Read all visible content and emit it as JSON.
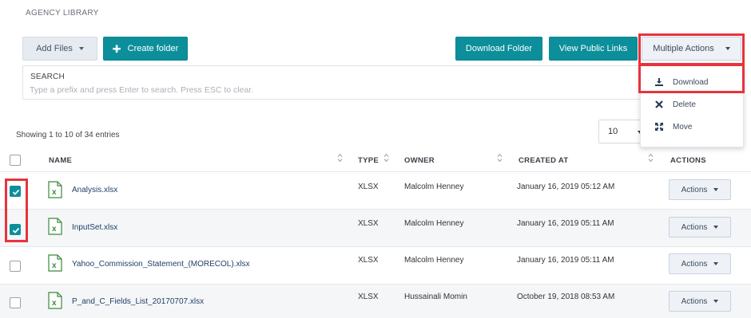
{
  "section_title": "AGENCY LIBRARY",
  "toolbar": {
    "add_files": "Add Files",
    "create_folder": "Create folder",
    "download_folder": "Download Folder",
    "view_public_links": "View Public Links",
    "multiple_actions": "Multiple Actions"
  },
  "multiple_actions_menu": {
    "items": [
      {
        "label": "Download",
        "icon": "download-icon"
      },
      {
        "label": "Delete",
        "icon": "close-icon"
      },
      {
        "label": "Move",
        "icon": "move-arrows-icon"
      }
    ]
  },
  "search": {
    "label": "SEARCH",
    "placeholder": "Type a prefix and press Enter to search. Press ESC to clear."
  },
  "entries_info": "Showing 1 to 10 of 34 entries",
  "per_page": "10",
  "table": {
    "columns": [
      "NAME",
      "TYPE",
      "OWNER",
      "CREATED AT",
      "ACTIONS"
    ],
    "rows": [
      {
        "name": "Analysis.xlsx",
        "type": "XLSX",
        "owner": "Malcolm Henney",
        "created_at": "January 16, 2019 05:12 AM",
        "checked": true,
        "action": "Actions"
      },
      {
        "name": "InputSet.xlsx",
        "type": "XLSX",
        "owner": "Malcolm Henney",
        "created_at": "January 16, 2019 05:11 AM",
        "checked": true,
        "action": "Actions"
      },
      {
        "name": "Yahoo_Commission_Statement_(MORECOL).xlsx",
        "type": "XLSX",
        "owner": "Malcolm Henney",
        "created_at": "January 16, 2019 05:11 AM",
        "checked": false,
        "action": "Actions"
      },
      {
        "name": "P_and_C_Fields_List_20170707.xlsx",
        "type": "XLSX",
        "owner": "Hussainali Momin",
        "created_at": "October 19, 2018 08:53 AM",
        "checked": false,
        "action": "Actions"
      }
    ]
  },
  "colors": {
    "accent": "#0c8f9b",
    "highlight": "#e8333c",
    "file_icon": "#3a8a3a"
  }
}
